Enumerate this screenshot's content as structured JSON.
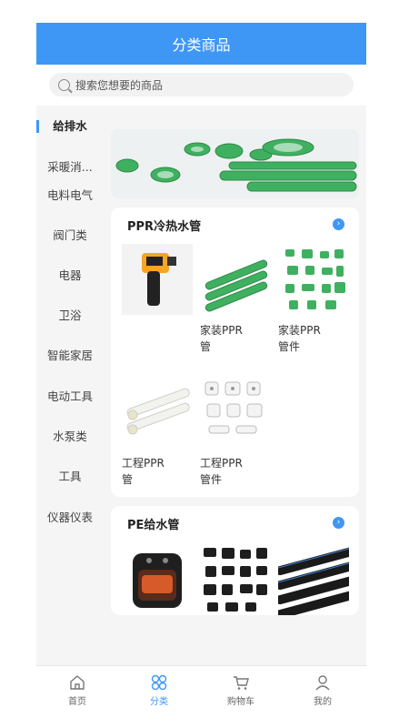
{
  "header": {
    "title": "分类商品"
  },
  "search": {
    "placeholder": "搜索您想要的商品"
  },
  "sidebar": {
    "items": [
      {
        "label": "给排水",
        "active": true
      },
      {
        "label": "采暖消..."
      },
      {
        "label": "电料电气"
      },
      {
        "label": "阀门类"
      },
      {
        "label": "电器"
      },
      {
        "label": "卫浴"
      },
      {
        "label": "智能家居"
      },
      {
        "label": "电动工具"
      },
      {
        "label": "水泵类"
      },
      {
        "label": "工具"
      },
      {
        "label": "仪器仪表"
      }
    ]
  },
  "sections": [
    {
      "title": "PPR冷热水管",
      "more_icon": "chevron-right-icon",
      "products": [
        {
          "name": "",
          "icon": "infrared-thermometer"
        },
        {
          "name": "家装PPR\n管",
          "icon": "green-ppr-pipes"
        },
        {
          "name": "家装PPR\n管件",
          "icon": "green-ppr-fittings"
        },
        {
          "name": "工程PPR\n管",
          "icon": "white-ppr-pipes"
        },
        {
          "name": "工程PPR\n管件",
          "icon": "white-ppr-fittings"
        }
      ]
    },
    {
      "title": "PE给水管",
      "more_icon": "chevron-right-icon",
      "products": [
        {
          "name": "",
          "icon": "air-fryer"
        },
        {
          "name": "",
          "icon": "black-pe-fittings"
        },
        {
          "name": "",
          "icon": "black-pe-pipes"
        }
      ]
    }
  ],
  "tabbar": {
    "items": [
      {
        "label": "首页",
        "icon": "home-icon"
      },
      {
        "label": "分类",
        "icon": "category-icon",
        "active": true
      },
      {
        "label": "购物车",
        "icon": "cart-icon"
      },
      {
        "label": "我的",
        "icon": "user-icon"
      }
    ]
  },
  "colors": {
    "accent": "#3f97f5",
    "pipe_green": "#3fb060"
  }
}
